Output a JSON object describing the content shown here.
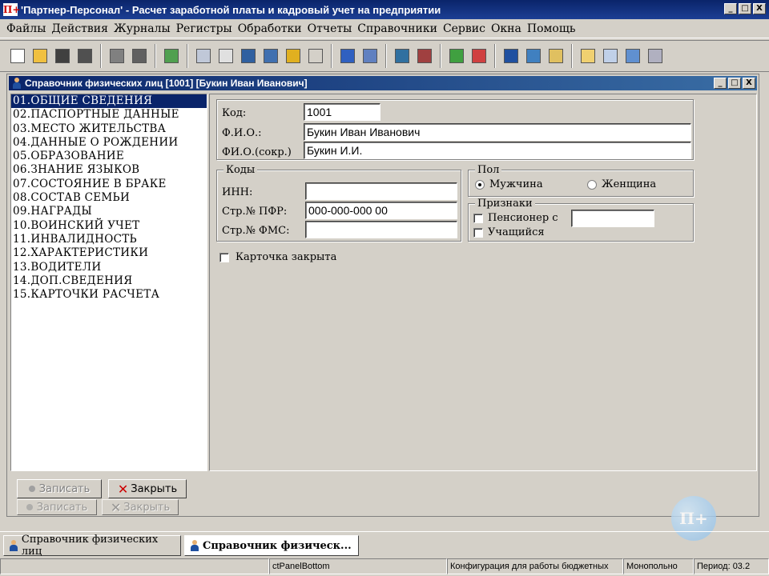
{
  "app": {
    "logo_text": "П+",
    "title": "'Партнер-Персонал' - Расчет заработной платы и кадровый учет на предприятии"
  },
  "window_buttons": {
    "minimize": "_",
    "maximize": "□",
    "close": "X"
  },
  "menu": [
    "Файлы",
    "Действия",
    "Журналы",
    "Регистры",
    "Обработки",
    "Отчеты",
    "Справочники",
    "Сервис",
    "Окна",
    "Помощь"
  ],
  "child": {
    "title": "Справочник физических лиц [1001] [Букин Иван Иванович]"
  },
  "sections": [
    "01.ОБЩИЕ СВЕДЕНИЯ",
    "02.ПАСПОРТНЫЕ ДАННЫЕ",
    "03.МЕСТО ЖИТЕЛЬСТВА",
    "04.ДАННЫЕ О РОЖДЕНИИ",
    "05.ОБРАЗОВАНИЕ",
    "06.ЗНАНИЕ ЯЗЫКОВ",
    "07.СОСТОЯНИЕ В БРАКЕ",
    "08.СОСТАВ СЕМЬИ",
    "09.НАГРАДЫ",
    "10.ВОИНСКИЙ УЧЕТ",
    "11.ИНВАЛИДНОСТЬ",
    "12.ХАРАКТЕРИСТИКИ",
    "13.ВОДИТЕЛИ",
    "14.ДОП.СВЕДЕНИЯ",
    "15.КАРТОЧКИ РАСЧЕТА"
  ],
  "form": {
    "code_label": "Код:",
    "code_value": "1001",
    "fio_label": "Ф.И.О.:",
    "fio_value": "Букин Иван Иванович",
    "fio_short_label": "ФИ.О.(сокр.)",
    "fio_short_value": "Букин И.И.",
    "codes_group": "Коды",
    "inn_label": "ИНН:",
    "inn_value": "",
    "pfr_label": "Стр.№ ПФР:",
    "pfr_value": "000-000-000 00",
    "fms_label": "Стр.№ ФМС:",
    "fms_value": "",
    "gender_group": "Пол",
    "male_label": "Мужчина",
    "female_label": "Женщина",
    "gender_selected": "male",
    "signs_group": "Признаки",
    "pensioner_label": "Пенсионер с",
    "pensioner_date": "",
    "student_label": "Учащийся",
    "card_closed_label": "Карточка закрыта"
  },
  "buttons": {
    "save": "Записать",
    "close": "Закрыть"
  },
  "tabs": [
    "Справочник физических лиц",
    "Справочник физическ..."
  ],
  "status": {
    "panel2": "ctPanelBottom",
    "panel3": "Конфигурация для работы бюджетных",
    "panel4": "Монопольно",
    "panel5": "Период: 03.2"
  },
  "watermark": "П+",
  "colors": {
    "title_bar": "#0a246a",
    "selection": "#0a246a",
    "face": "#d4d0c8"
  }
}
